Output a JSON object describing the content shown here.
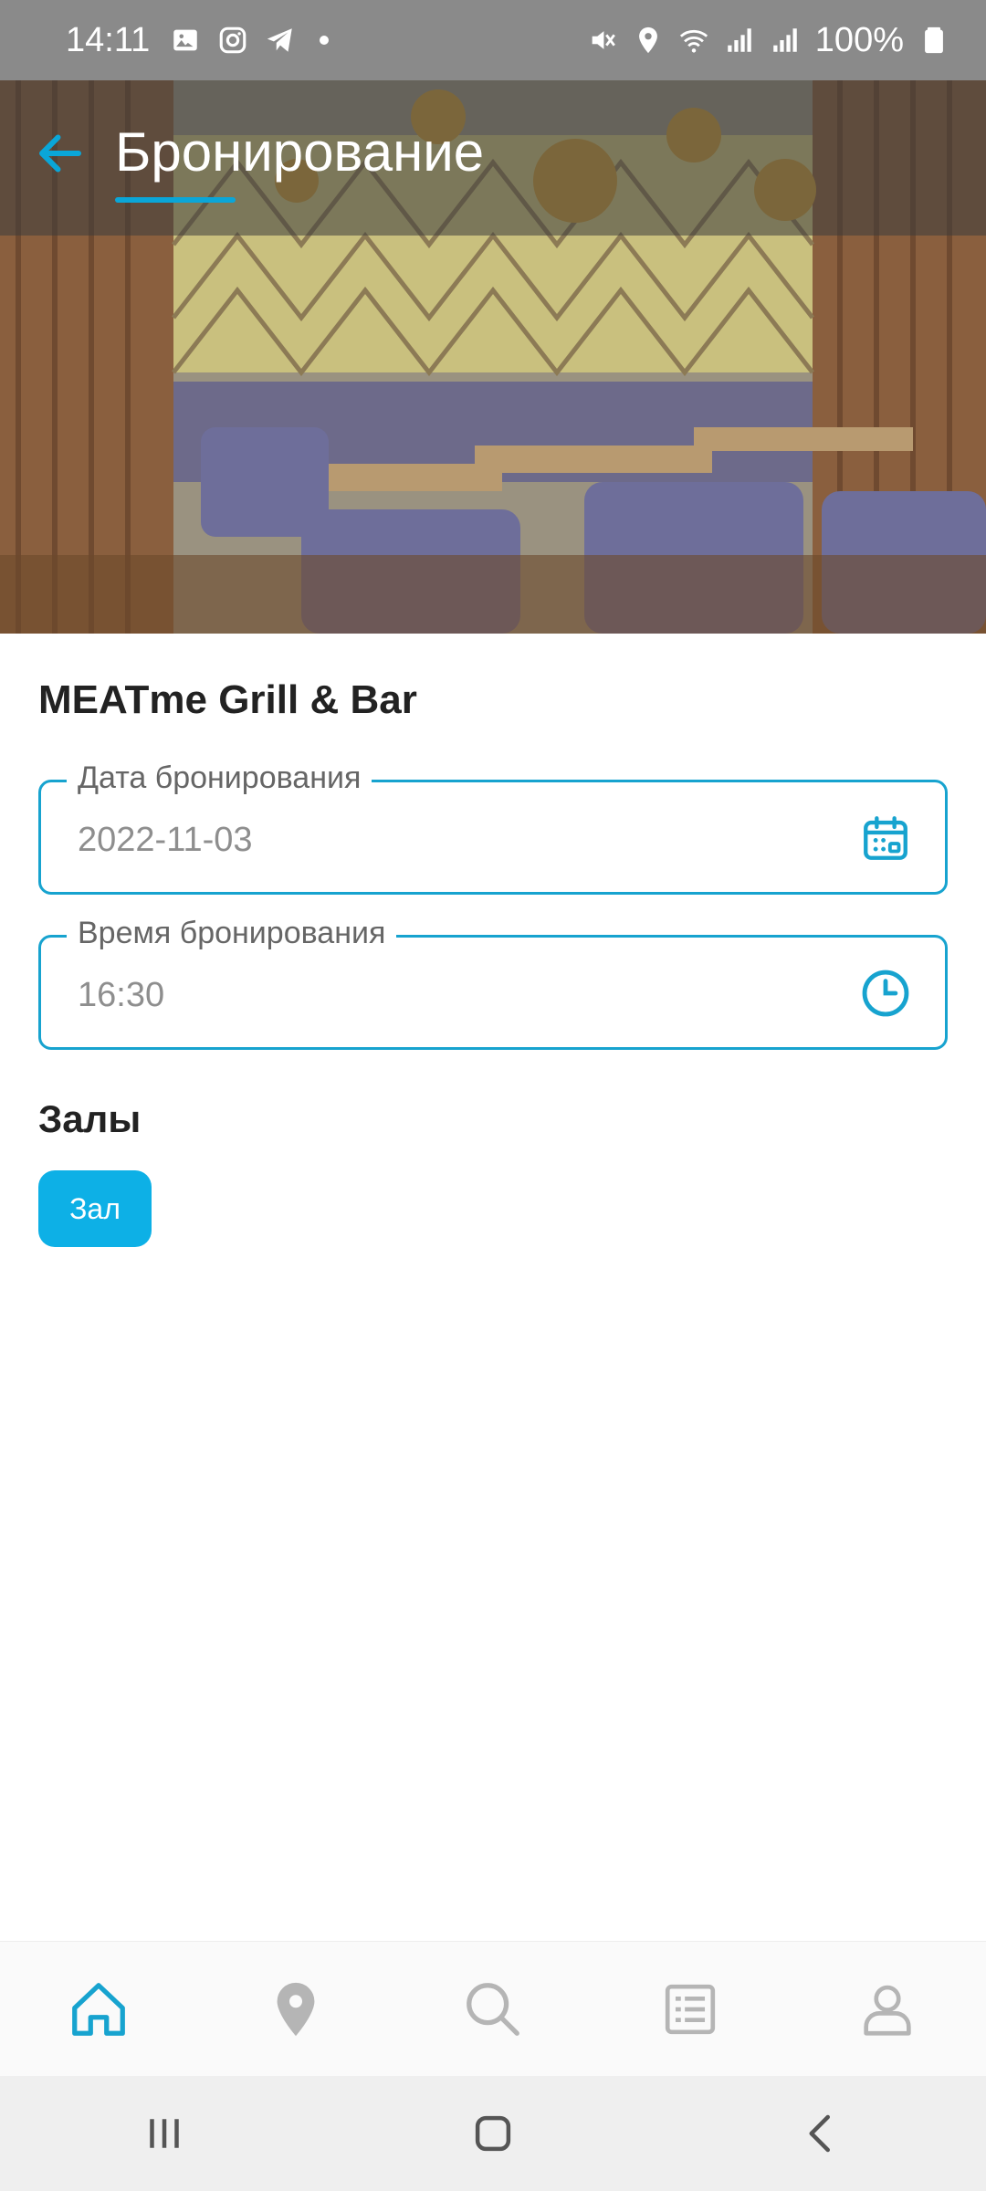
{
  "status_bar": {
    "time": "14:11",
    "battery": "100%",
    "left_icons": [
      "gallery-icon",
      "instagram-icon",
      "telegram-icon"
    ],
    "right_icons": [
      "mute-icon",
      "location-icon",
      "wifi-icon",
      "signal-icon",
      "signal-icon",
      "battery-icon"
    ]
  },
  "header": {
    "title": "Бронирование",
    "back_icon": "arrow-left-icon",
    "accent_color": "#0aa6d8"
  },
  "restaurant": {
    "name": "MEATme Grill & Bar"
  },
  "form": {
    "date": {
      "label": "Дата бронирования",
      "value": "2022-11-03",
      "icon": "calendar-icon"
    },
    "time": {
      "label": "Время бронирования",
      "value": "16:30",
      "icon": "clock-icon"
    }
  },
  "halls": {
    "title": "Залы",
    "items": [
      {
        "label": "Зал",
        "selected": true
      }
    ]
  },
  "bottom_nav": {
    "items": [
      {
        "icon": "home-icon",
        "active": true
      },
      {
        "icon": "map-pin-icon",
        "active": false
      },
      {
        "icon": "search-icon",
        "active": false
      },
      {
        "icon": "list-icon",
        "active": false
      },
      {
        "icon": "profile-icon",
        "active": false
      }
    ]
  },
  "colors": {
    "accent": "#0db0e6",
    "field_border": "#17a3cf",
    "nav_inactive": "#b5b5b5"
  }
}
